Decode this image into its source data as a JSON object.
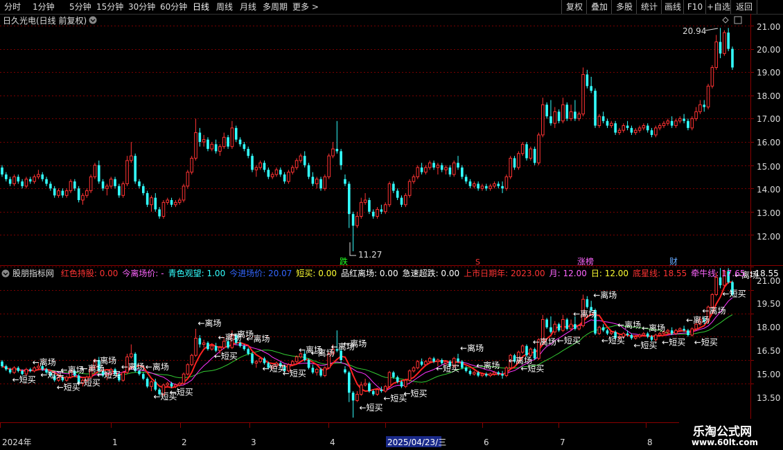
{
  "toolbar": {
    "left": [
      "分时",
      "1分钟",
      "5分钟",
      "15分钟",
      "30分钟",
      "60分钟",
      "日线",
      "周线",
      "月线",
      "多周期",
      "更多 >"
    ],
    "right": [
      "复权",
      "叠加",
      "多股",
      "统计",
      "画线",
      "F10",
      "+自选",
      "返回"
    ]
  },
  "main_panel": {
    "title": "日久光电(日线 前复权)",
    "y_labels": [
      "21.00",
      "20.00",
      "19.00",
      "18.00",
      "17.00",
      "16.00",
      "15.00",
      "14.00",
      "13.00",
      "12.00"
    ],
    "high_label": "20.94",
    "low_label": "11.27",
    "event_labels": [
      {
        "text": "跌",
        "color": "#22ff22"
      },
      {
        "text": "S",
        "color": "#ff3333"
      },
      {
        "text": "涨榜",
        "color": "#ff66ff"
      },
      {
        "text": "财",
        "color": "#66aaff"
      }
    ]
  },
  "indicator_panel": {
    "title": "股朋指标网",
    "legend": [
      {
        "text": "红色持股: 0.00",
        "color": "#ff3333"
      },
      {
        "text": "今离场价: -",
        "color": "#ff66ff"
      },
      {
        "text": "青色观望: 1.00",
        "color": "#33ffff"
      },
      {
        "text": "今进场价: 20.07",
        "color": "#3366ff"
      },
      {
        "text": "短买: 0.00",
        "color": "#ffff33"
      },
      {
        "text": "品红离场: 0.00",
        "color": "#ffffff"
      },
      {
        "text": "急速超跌: 0.00",
        "color": "#ffffff"
      },
      {
        "text": "上市日期年: 2023.00",
        "color": "#ff3333"
      },
      {
        "text": "月: 12.00",
        "color": "#ff66ff"
      },
      {
        "text": "日: 12.00",
        "color": "#ffff33"
      },
      {
        "text": "底星线: 18.55",
        "color": "#ff3333"
      },
      {
        "text": "牵牛线: 17.65",
        "color": "#ff66ff"
      },
      {
        "text": ": 18.55",
        "color": "#ffffff"
      },
      {
        "text": ": 18.5",
        "color": "#ff3333"
      }
    ],
    "y_labels": [
      "21.00",
      "19.50",
      "18.00",
      "16.50",
      "15.00",
      "13.50"
    ],
    "exit_label": "←离场",
    "buy_label": "←短买"
  },
  "x_axis": {
    "labels": [
      "2024年",
      "1",
      "2",
      "3",
      "4",
      "2025/04/23/三",
      "6",
      "7",
      "8"
    ]
  },
  "watermark": {
    "line1": "乐淘公式网",
    "line2": "www.60lt.com"
  },
  "colors": {
    "up": "#ff3333",
    "down": "#33ffff",
    "grid": "#7a0000",
    "axis": "#8b0000"
  },
  "chart_data": {
    "type": "candlestick",
    "ylim": [
      11.2,
      21.3
    ],
    "candles": [
      [
        14.9,
        15.0,
        14.5,
        14.6
      ],
      [
        14.6,
        14.7,
        14.3,
        14.4
      ],
      [
        14.4,
        14.5,
        14.1,
        14.2
      ],
      [
        14.2,
        14.6,
        14.1,
        14.5
      ],
      [
        14.5,
        14.6,
        14.2,
        14.3
      ],
      [
        14.3,
        14.4,
        14.0,
        14.1
      ],
      [
        14.1,
        14.5,
        14.0,
        14.4
      ],
      [
        14.4,
        14.5,
        14.2,
        14.3
      ],
      [
        14.3,
        14.6,
        14.2,
        14.5
      ],
      [
        14.5,
        14.8,
        14.4,
        14.6
      ],
      [
        14.6,
        14.7,
        14.3,
        14.4
      ],
      [
        14.4,
        14.5,
        14.1,
        14.2
      ],
      [
        14.2,
        14.3,
        13.9,
        14.0
      ],
      [
        14.0,
        14.1,
        13.6,
        13.7
      ],
      [
        13.7,
        14.0,
        13.6,
        13.9
      ],
      [
        13.9,
        14.0,
        13.6,
        13.7
      ],
      [
        13.7,
        14.0,
        13.6,
        13.9
      ],
      [
        13.9,
        14.4,
        13.8,
        14.3
      ],
      [
        14.3,
        14.4,
        13.9,
        14.0
      ],
      [
        14.0,
        14.1,
        13.4,
        13.5
      ],
      [
        13.5,
        13.8,
        13.3,
        13.7
      ],
      [
        13.7,
        14.0,
        13.6,
        13.9
      ],
      [
        13.9,
        14.6,
        13.8,
        14.5
      ],
      [
        14.5,
        15.1,
        14.4,
        15.0
      ],
      [
        15.0,
        15.2,
        14.2,
        14.3
      ],
      [
        14.3,
        14.4,
        13.9,
        14.0
      ],
      [
        14.0,
        14.2,
        13.7,
        14.1
      ],
      [
        14.1,
        14.5,
        14.0,
        14.4
      ],
      [
        14.4,
        14.5,
        14.0,
        14.1
      ],
      [
        14.1,
        14.2,
        13.6,
        13.7
      ],
      [
        13.7,
        14.3,
        13.6,
        14.2
      ],
      [
        14.2,
        15.4,
        14.1,
        15.2
      ],
      [
        15.2,
        16.0,
        15.1,
        15.4
      ],
      [
        15.4,
        15.5,
        14.2,
        14.3
      ],
      [
        14.3,
        14.4,
        14.0,
        14.1
      ],
      [
        14.1,
        14.2,
        13.7,
        13.8
      ],
      [
        13.8,
        13.9,
        13.2,
        13.3
      ],
      [
        13.3,
        13.7,
        13.0,
        13.6
      ],
      [
        13.6,
        13.8,
        13.0,
        13.1
      ],
      [
        13.1,
        13.2,
        12.7,
        12.8
      ],
      [
        12.8,
        13.5,
        12.7,
        13.4
      ],
      [
        13.4,
        13.6,
        13.3,
        13.5
      ],
      [
        13.5,
        13.6,
        13.2,
        13.3
      ],
      [
        13.3,
        13.5,
        13.2,
        13.4
      ],
      [
        13.4,
        13.6,
        13.3,
        13.5
      ],
      [
        13.5,
        14.2,
        13.4,
        14.1
      ],
      [
        14.1,
        14.8,
        14.0,
        14.7
      ],
      [
        14.7,
        15.4,
        14.6,
        15.3
      ],
      [
        15.3,
        17.0,
        15.2,
        16.4
      ],
      [
        16.4,
        16.6,
        15.8,
        16.0
      ],
      [
        16.0,
        16.3,
        15.8,
        16.1
      ],
      [
        16.1,
        16.2,
        15.6,
        15.7
      ],
      [
        15.7,
        16.0,
        15.6,
        15.9
      ],
      [
        15.9,
        16.1,
        15.5,
        15.6
      ],
      [
        15.6,
        15.9,
        15.4,
        15.8
      ],
      [
        15.8,
        16.4,
        15.7,
        16.2
      ],
      [
        16.2,
        16.3,
        15.7,
        15.8
      ],
      [
        15.8,
        16.9,
        15.7,
        16.6
      ],
      [
        16.6,
        16.7,
        16.0,
        16.1
      ],
      [
        16.1,
        16.2,
        15.8,
        15.9
      ],
      [
        15.9,
        16.0,
        15.6,
        15.7
      ],
      [
        15.7,
        15.8,
        15.3,
        15.4
      ],
      [
        15.4,
        15.5,
        14.7,
        14.8
      ],
      [
        14.8,
        15.0,
        14.5,
        14.9
      ],
      [
        14.9,
        15.2,
        14.8,
        15.1
      ],
      [
        15.1,
        15.2,
        14.7,
        14.8
      ],
      [
        14.8,
        14.9,
        14.4,
        14.5
      ],
      [
        14.5,
        14.7,
        14.4,
        14.6
      ],
      [
        14.6,
        14.9,
        14.5,
        14.8
      ],
      [
        14.8,
        14.9,
        14.5,
        14.6
      ],
      [
        14.6,
        14.7,
        14.2,
        14.3
      ],
      [
        14.3,
        14.8,
        14.2,
        14.7
      ],
      [
        14.7,
        15.0,
        14.6,
        14.9
      ],
      [
        14.9,
        15.3,
        14.8,
        15.2
      ],
      [
        15.2,
        15.5,
        15.1,
        15.4
      ],
      [
        15.4,
        15.6,
        14.9,
        15.0
      ],
      [
        15.0,
        15.1,
        14.4,
        14.5
      ],
      [
        14.5,
        14.7,
        14.1,
        14.2
      ],
      [
        14.2,
        14.5,
        14.0,
        14.4
      ],
      [
        14.4,
        14.5,
        13.9,
        14.0
      ],
      [
        14.0,
        14.6,
        13.9,
        14.5
      ],
      [
        14.5,
        15.5,
        14.4,
        15.4
      ],
      [
        15.4,
        16.0,
        15.3,
        15.7
      ],
      [
        15.7,
        16.9,
        15.5,
        15.6
      ],
      [
        15.6,
        15.7,
        14.8,
        15.0
      ],
      [
        14.4,
        14.6,
        14.1,
        14.2
      ],
      [
        14.2,
        14.3,
        12.3,
        12.9
      ],
      [
        12.9,
        13.0,
        11.3,
        12.4
      ],
      [
        12.4,
        13.0,
        12.3,
        12.8
      ],
      [
        12.8,
        13.6,
        12.7,
        13.4
      ],
      [
        13.4,
        13.8,
        13.3,
        13.5
      ],
      [
        13.5,
        13.6,
        12.9,
        13.0
      ],
      [
        13.0,
        13.1,
        12.7,
        12.8
      ],
      [
        12.8,
        13.2,
        12.7,
        13.1
      ],
      [
        13.1,
        13.3,
        12.9,
        13.0
      ],
      [
        13.0,
        13.4,
        12.9,
        13.3
      ],
      [
        13.3,
        14.3,
        13.2,
        14.2
      ],
      [
        14.2,
        14.3,
        13.8,
        13.9
      ],
      [
        13.9,
        14.0,
        13.5,
        13.6
      ],
      [
        13.6,
        13.7,
        13.2,
        13.3
      ],
      [
        13.3,
        13.8,
        13.2,
        13.7
      ],
      [
        13.7,
        14.4,
        13.6,
        14.3
      ],
      [
        14.3,
        14.6,
        14.2,
        14.5
      ],
      [
        14.5,
        15.0,
        14.4,
        14.9
      ],
      [
        14.9,
        15.1,
        14.6,
        14.7
      ],
      [
        14.7,
        15.0,
        14.6,
        14.9
      ],
      [
        14.9,
        15.2,
        14.8,
        15.1
      ],
      [
        15.1,
        15.2,
        14.8,
        14.9
      ],
      [
        14.9,
        15.1,
        14.6,
        15.0
      ],
      [
        15.0,
        15.1,
        14.7,
        14.8
      ],
      [
        14.8,
        15.0,
        14.6,
        14.9
      ],
      [
        14.9,
        15.0,
        14.5,
        14.6
      ],
      [
        14.6,
        15.2,
        14.5,
        15.1
      ],
      [
        15.1,
        15.4,
        14.8,
        14.9
      ],
      [
        14.9,
        15.0,
        14.4,
        14.5
      ],
      [
        14.5,
        14.6,
        14.2,
        14.3
      ],
      [
        14.3,
        14.4,
        14.0,
        14.1
      ],
      [
        14.1,
        14.3,
        14.0,
        14.2
      ],
      [
        14.2,
        14.3,
        13.9,
        14.0
      ],
      [
        14.0,
        14.2,
        13.9,
        14.1
      ],
      [
        14.1,
        14.2,
        13.9,
        14.0
      ],
      [
        14.0,
        14.2,
        13.9,
        14.1
      ],
      [
        14.1,
        14.3,
        14.0,
        14.2
      ],
      [
        14.2,
        14.3,
        14.0,
        14.1
      ],
      [
        14.1,
        14.3,
        13.8,
        14.0
      ],
      [
        14.0,
        14.6,
        13.9,
        14.5
      ],
      [
        14.5,
        15.4,
        14.4,
        15.3
      ],
      [
        15.3,
        15.4,
        14.8,
        14.9
      ],
      [
        14.9,
        15.6,
        14.8,
        15.5
      ],
      [
        15.5,
        16.0,
        15.4,
        15.9
      ],
      [
        15.9,
        16.0,
        15.2,
        15.3
      ],
      [
        15.3,
        15.8,
        15.2,
        15.7
      ],
      [
        15.7,
        15.8,
        15.0,
        15.1
      ],
      [
        15.1,
        16.4,
        15.0,
        16.3
      ],
      [
        16.3,
        17.9,
        16.2,
        17.6
      ],
      [
        17.6,
        17.7,
        17.0,
        17.1
      ],
      [
        17.1,
        17.8,
        16.7,
        16.8
      ],
      [
        16.8,
        17.5,
        16.6,
        17.3
      ],
      [
        17.3,
        17.4,
        16.8,
        16.9
      ],
      [
        16.9,
        17.9,
        16.8,
        17.6
      ],
      [
        17.6,
        17.7,
        16.9,
        17.0
      ],
      [
        17.0,
        17.6,
        16.9,
        17.3
      ],
      [
        17.3,
        17.8,
        16.9,
        17.0
      ],
      [
        17.0,
        17.3,
        16.9,
        17.2
      ],
      [
        17.2,
        19.2,
        17.1,
        18.9
      ],
      [
        18.9,
        19.1,
        18.3,
        18.4
      ],
      [
        18.4,
        18.8,
        18.1,
        18.2
      ],
      [
        18.2,
        18.3,
        16.6,
        16.7
      ],
      [
        16.7,
        17.2,
        16.6,
        17.1
      ],
      [
        17.1,
        17.3,
        16.8,
        16.9
      ],
      [
        16.9,
        17.0,
        16.6,
        16.7
      ],
      [
        16.7,
        16.9,
        16.6,
        16.8
      ],
      [
        16.8,
        16.9,
        16.3,
        16.4
      ],
      [
        16.4,
        16.6,
        16.3,
        16.5
      ],
      [
        16.5,
        16.8,
        16.4,
        16.7
      ],
      [
        16.7,
        16.9,
        16.5,
        16.6
      ],
      [
        16.6,
        16.7,
        16.3,
        16.4
      ],
      [
        16.4,
        16.6,
        16.3,
        16.5
      ],
      [
        16.5,
        16.7,
        16.4,
        16.6
      ],
      [
        16.6,
        16.8,
        16.5,
        16.7
      ],
      [
        16.7,
        16.8,
        16.4,
        16.5
      ],
      [
        16.5,
        16.6,
        16.2,
        16.3
      ],
      [
        16.3,
        16.7,
        16.2,
        16.6
      ],
      [
        16.6,
        16.8,
        16.5,
        16.7
      ],
      [
        16.7,
        16.9,
        16.6,
        16.8
      ],
      [
        16.8,
        17.0,
        16.7,
        16.9
      ],
      [
        16.9,
        17.1,
        16.6,
        16.7
      ],
      [
        16.7,
        17.0,
        16.6,
        16.9
      ],
      [
        16.9,
        17.1,
        16.8,
        17.0
      ],
      [
        17.0,
        17.2,
        16.8,
        16.9
      ],
      [
        16.9,
        17.0,
        16.5,
        16.6
      ],
      [
        16.6,
        17.1,
        16.5,
        17.0
      ],
      [
        17.0,
        17.5,
        16.9,
        17.3
      ],
      [
        17.3,
        17.8,
        17.2,
        17.6
      ],
      [
        17.6,
        17.8,
        17.3,
        17.5
      ],
      [
        17.5,
        18.5,
        17.4,
        18.4
      ],
      [
        18.4,
        19.3,
        18.3,
        19.2
      ],
      [
        19.2,
        20.6,
        19.1,
        20.3
      ],
      [
        20.3,
        20.9,
        19.6,
        19.8
      ],
      [
        19.8,
        20.8,
        19.7,
        20.7
      ],
      [
        20.7,
        20.9,
        19.9,
        20.0
      ],
      [
        20.0,
        20.1,
        19.1,
        19.2
      ]
    ]
  }
}
